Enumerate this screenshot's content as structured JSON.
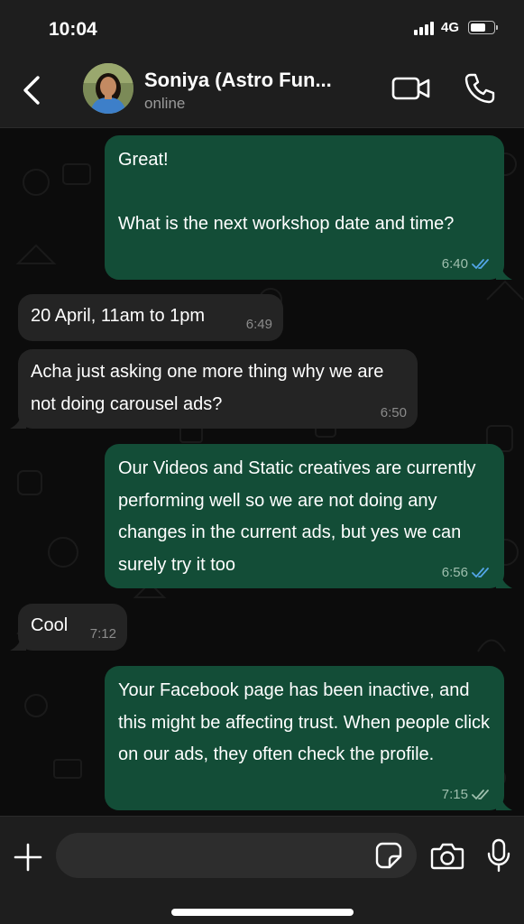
{
  "status_bar": {
    "time": "10:04",
    "network": "4G",
    "battery_level": 0.65
  },
  "header": {
    "back_icon": "chevron-left-icon",
    "contact_name": "Soniya (Astro Fun...",
    "contact_status": "online",
    "video_icon": "video-camera-icon",
    "call_icon": "phone-icon"
  },
  "messages": [
    {
      "direction": "outgoing",
      "text": "Great!\n\nWhat is the next workshop date and time?",
      "time": "6:40",
      "ticks": "read"
    },
    {
      "direction": "incoming",
      "text": "20 April, 11am to 1pm",
      "time": "6:49"
    },
    {
      "direction": "incoming",
      "text": "Acha just asking one more thing why we are not doing carousel ads?",
      "time": "6:50"
    },
    {
      "direction": "outgoing",
      "text": "Our Videos and Static creatives are currently performing well so we are not doing any changes in the current ads, but yes we can surely try it too",
      "time": "6:56",
      "ticks": "read"
    },
    {
      "direction": "incoming",
      "text": "Cool",
      "time": "7:12"
    },
    {
      "direction": "outgoing",
      "text": "Your Facebook page has been inactive, and this might be affecting trust. When people click on our ads, they often check the profile.",
      "time": "7:15",
      "ticks": "delivered"
    }
  ],
  "input_bar": {
    "plus_icon": "plus-icon",
    "message_placeholder": "",
    "sticker_icon": "sticker-icon",
    "camera_icon": "camera-icon",
    "mic_icon": "microphone-icon"
  },
  "colors": {
    "outgoing_bubble": "#134d37",
    "incoming_bubble": "#242424",
    "read_ticks": "#53a6e7",
    "delivered_ticks": "#9fbfae"
  }
}
